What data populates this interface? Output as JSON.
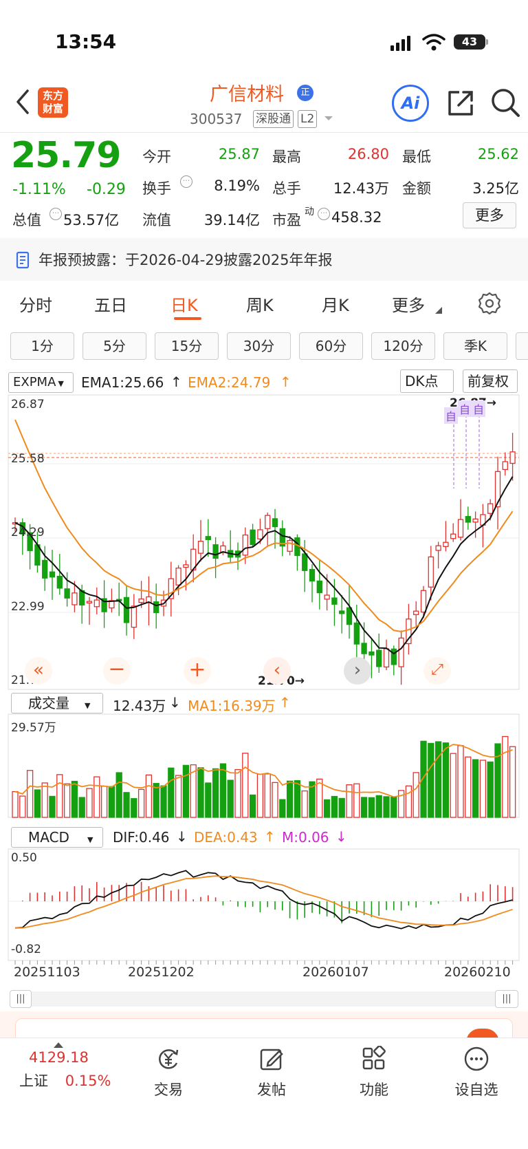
{
  "status": {
    "time": "13:54",
    "battery": "43"
  },
  "header": {
    "logo_line1": "东方",
    "logo_line2": "财富",
    "stock_name": "广信材料",
    "badge": "正",
    "code": "300537",
    "tag1": "深股通",
    "tag2": "L2",
    "ai_label": "Ai"
  },
  "quote": {
    "price": "25.79",
    "change_pct": "-1.11%",
    "change": "-0.29",
    "open_label": "今开",
    "open": "25.87",
    "high_label": "最高",
    "high": "26.80",
    "low_label": "最低",
    "low": "25.62",
    "turnover_label": "换手",
    "turnover": "8.19%",
    "volume_label": "总手",
    "volume": "12.43万",
    "amount_label": "金额",
    "amount": "3.25亿",
    "mcap_label": "总值",
    "mcap": "53.57亿",
    "float_label": "流值",
    "float": "39.14亿",
    "pe_label": "市盈",
    "pe_sup": "动",
    "pe": "458.32",
    "more": "更多"
  },
  "notice": "年报预披露：于2026-04-29披露2025年年报",
  "period_tabs": [
    "分时",
    "五日",
    "日K",
    "周K",
    "月K",
    "更多"
  ],
  "minute_buttons": [
    "1分",
    "5分",
    "15分",
    "30分",
    "60分",
    "120分",
    "季K"
  ],
  "kline": {
    "indicator": "EXPMA",
    "ema1": "EMA1:25.66",
    "ema2": "EMA2:24.79",
    "dk_btn": "DK点",
    "adjust_btn": "前复权",
    "y_top": "26.87",
    "y_mid1": "25.58",
    "y_mid2": "24.29",
    "y_mid3": "22.99",
    "y_bottom": "21.70",
    "max_marker": "26.87",
    "min_marker": "21.70",
    "self_tag": "自"
  },
  "volume": {
    "indicator": "成交量",
    "value": "12.43万",
    "ma1": "MA1:16.39万",
    "y_top": "29.57万"
  },
  "macd": {
    "indicator": "MACD",
    "dif": "DIF:0.46",
    "dea": "DEA:0.43",
    "m": "M:0.06",
    "y_top": "0.50",
    "y_bottom": "-0.82"
  },
  "dates": [
    "20251103",
    "20251202",
    "20260107",
    "20260210"
  ],
  "bottom_nav": {
    "index_value": "4129.18",
    "index_name": "上证",
    "index_change": "0.15%",
    "trade": "交易",
    "post": "发帖",
    "function": "功能",
    "watchlist": "设自选"
  },
  "colors": {
    "up": "#e0312f",
    "down": "#15a011",
    "brand": "#f05a22",
    "ema2": "#f08a1c"
  }
}
